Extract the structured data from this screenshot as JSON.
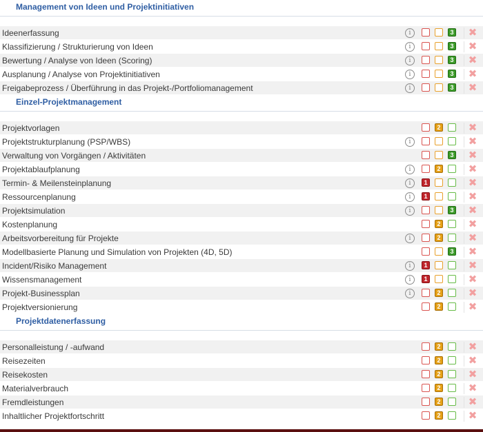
{
  "sections": [
    {
      "title": "Management von Ideen und Projektinitiativen",
      "rows": [
        {
          "label": "Ideenerfassung",
          "info": true,
          "rating": 3
        },
        {
          "label": "Klassifizierung / Strukturierung von Ideen",
          "info": true,
          "rating": 3
        },
        {
          "label": "Bewertung / Analyse von Ideen (Scoring)",
          "info": true,
          "rating": 3
        },
        {
          "label": "Ausplanung / Analyse von Projektinitiativen",
          "info": true,
          "rating": 3
        },
        {
          "label": "Freigabeprozess / Überführung in das Projekt-/Portfoliomanagement",
          "info": true,
          "rating": 3
        }
      ]
    },
    {
      "title": "Einzel-Projektmanagement",
      "rows": [
        {
          "label": "Projektvorlagen",
          "info": false,
          "rating": 2
        },
        {
          "label": "Projektstrukturplanung (PSP/WBS)",
          "info": true,
          "rating": 0
        },
        {
          "label": "Verwaltung von Vorgängen / Aktivitäten",
          "info": false,
          "rating": 3
        },
        {
          "label": "Projektablaufplanung",
          "info": true,
          "rating": 2
        },
        {
          "label": "Termin- & Meilensteinplanung",
          "info": true,
          "rating": 1
        },
        {
          "label": "Ressourcenplanung",
          "info": true,
          "rating": 1
        },
        {
          "label": "Projektsimulation",
          "info": true,
          "rating": 3
        },
        {
          "label": "Kostenplanung",
          "info": false,
          "rating": 2
        },
        {
          "label": "Arbeitsvorbereitung für Projekte",
          "info": true,
          "rating": 2
        },
        {
          "label": "Modellbasierte Planung und Simulation von Projekten (4D, 5D)",
          "info": false,
          "rating": 3
        },
        {
          "label": "Incident/Risiko Management",
          "info": true,
          "rating": 1
        },
        {
          "label": "Wissensmanagement",
          "info": true,
          "rating": 1
        },
        {
          "label": "Projekt-Businessplan",
          "info": true,
          "rating": 2
        },
        {
          "label": "Projektversionierung",
          "info": false,
          "rating": 2
        }
      ]
    },
    {
      "title": "Projektdatenerfassung",
      "rows": [
        {
          "label": "Personalleistung / -aufwand",
          "info": false,
          "rating": 2
        },
        {
          "label": "Reisezeiten",
          "info": false,
          "rating": 2
        },
        {
          "label": "Reisekosten",
          "info": false,
          "rating": 2
        },
        {
          "label": "Materialverbrauch",
          "info": false,
          "rating": 2
        },
        {
          "label": "Fremdleistungen",
          "info": false,
          "rating": 2
        },
        {
          "label": "Inhaltlicher Projektfortschritt",
          "info": false,
          "rating": 2
        }
      ]
    }
  ],
  "glyphs": {
    "info": "i",
    "delete": "✖",
    "rating_1": "1",
    "rating_2": "2",
    "rating_3": "3"
  },
  "colors": {
    "section_title": "#2f5ea3",
    "rating_1": "#c0262c",
    "rating_2": "#e6a117",
    "rating_3": "#3d9b2a",
    "row_alt": "#f1f1f1",
    "delete": "#f2a0a0"
  }
}
